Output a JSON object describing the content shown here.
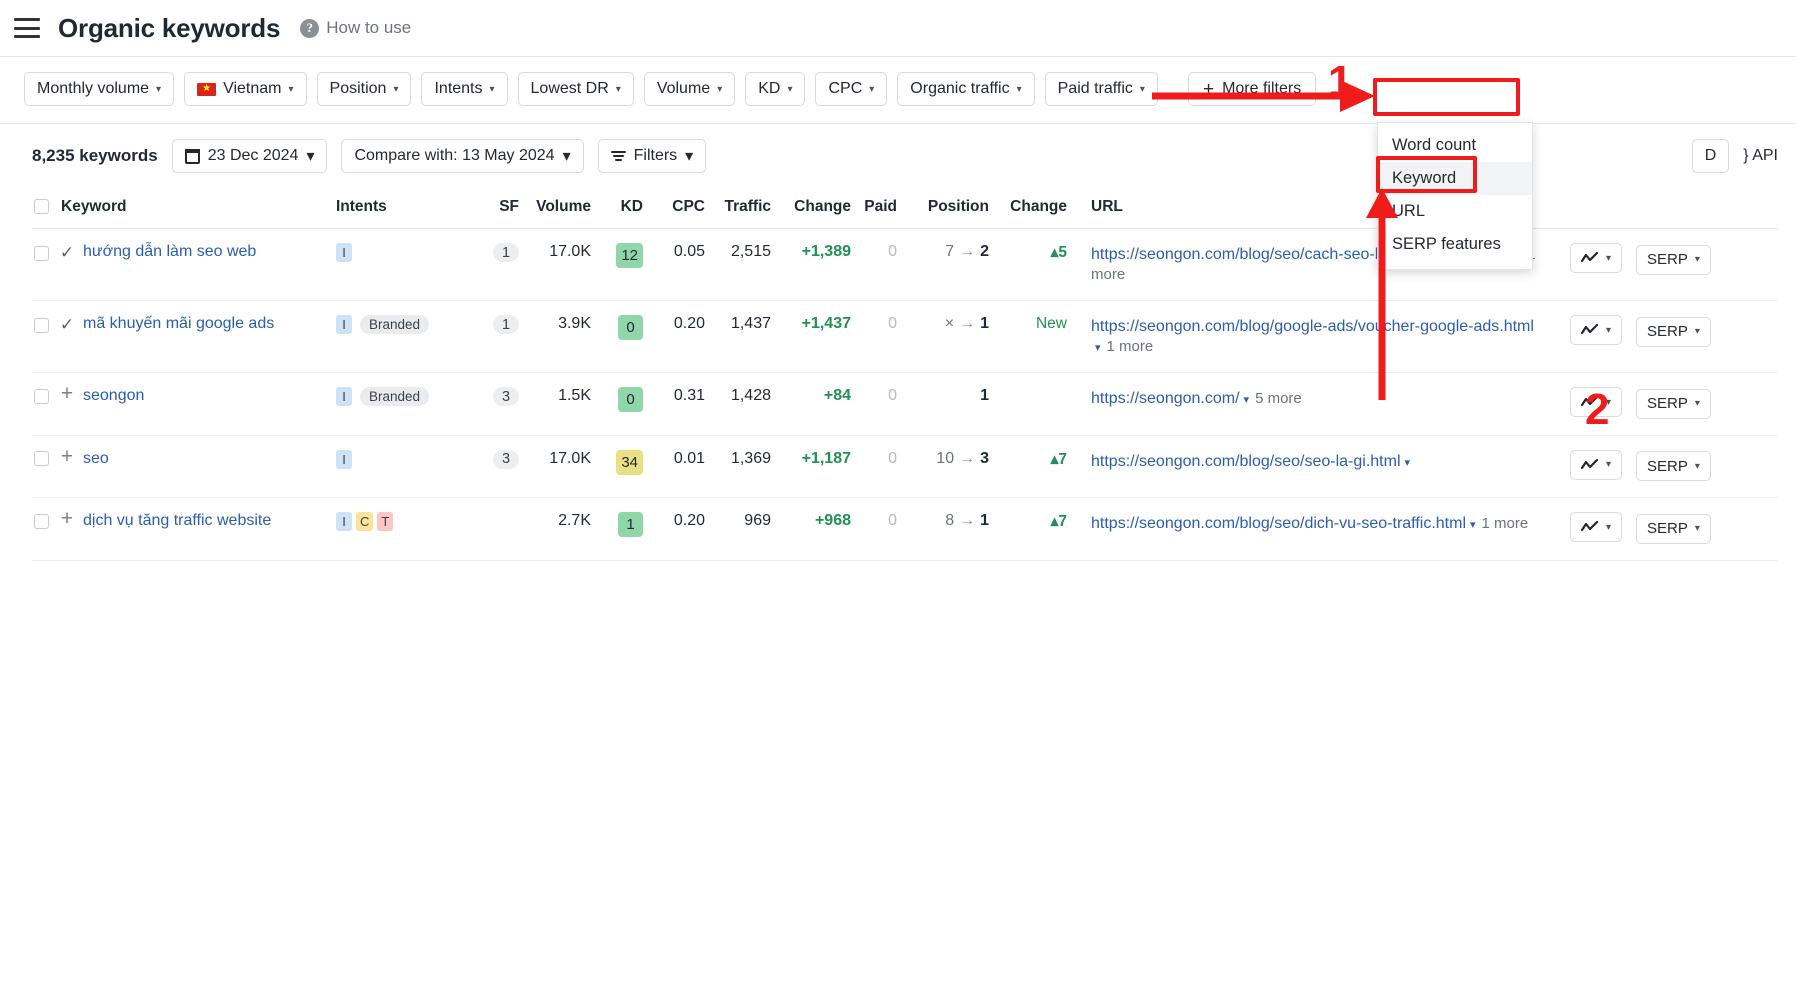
{
  "header": {
    "menu_icon": "hamburger-icon",
    "title": "Organic keywords",
    "help_icon": "?",
    "help_label": "How to use"
  },
  "filter_bar": {
    "buttons": [
      {
        "label": "Monthly volume",
        "caret": "▾"
      },
      {
        "label": "Vietnam",
        "caret": "▾",
        "flag": "★"
      },
      {
        "label": "Position",
        "caret": "▾"
      },
      {
        "label": "Intents",
        "caret": "▾"
      },
      {
        "label": "Lowest DR",
        "caret": "▾"
      },
      {
        "label": "Volume",
        "caret": "▾"
      },
      {
        "label": "KD",
        "caret": "▾"
      },
      {
        "label": "CPC",
        "caret": "▾"
      },
      {
        "label": "Organic traffic",
        "caret": "▾"
      },
      {
        "label": "Paid traffic",
        "caret": "▾"
      }
    ],
    "more_filters": {
      "plus": "+",
      "label": "More filters"
    }
  },
  "more_filters_dropdown": {
    "items": [
      {
        "label": "Word count",
        "highlighted": false
      },
      {
        "label": "Keyword",
        "highlighted": true
      },
      {
        "label": "URL",
        "highlighted": false
      },
      {
        "label": "SERP features",
        "highlighted": false
      }
    ]
  },
  "toolbar": {
    "keyword_count": "8,235 keywords",
    "date_button": "23 Dec 2024",
    "date_caret": "▾",
    "compare_button": "Compare with: 13 May 2024",
    "compare_caret": "▾",
    "filters_button": "Filters",
    "filters_caret": "▾",
    "export_label": "D",
    "api_label": "} API"
  },
  "table": {
    "columns": [
      "Keyword",
      "Intents",
      "SF",
      "Volume",
      "KD",
      "CPC",
      "Traffic",
      "Change",
      "Paid",
      "Position",
      "Change",
      "URL"
    ],
    "rows": [
      {
        "checked": false,
        "mark": "✓",
        "keyword": "hướng dẫn làm seo web",
        "intents": [
          {
            "code": "I",
            "type": "i"
          }
        ],
        "branded": null,
        "sf": "1",
        "volume": "17.0K",
        "kd": "12",
        "kd_color": "green",
        "cpc": "0.05",
        "traffic": "2,515",
        "change": "+1,389",
        "paid": "0",
        "pos_from": "7",
        "pos_arrow": "→",
        "pos_to": "2",
        "pos_change": "▴5",
        "pos_change_type": "up",
        "url": "https://seongon.com/blog/seo/cach-seo-len-top-google.html",
        "url_caret": "▾",
        "url_more": "1 more",
        "chart_button": "chart",
        "serp_button": "SERP"
      },
      {
        "checked": false,
        "mark": "✓",
        "keyword": "mã khuyến mãi google ads",
        "intents": [
          {
            "code": "I",
            "type": "i"
          }
        ],
        "branded": "Branded",
        "sf": "1",
        "volume": "3.9K",
        "kd": "0",
        "kd_color": "green",
        "cpc": "0.20",
        "traffic": "1,437",
        "change": "+1,437",
        "paid": "0",
        "pos_from": "×",
        "pos_arrow": "→",
        "pos_to": "1",
        "pos_change": "New",
        "pos_change_type": "new",
        "url": "https://seongon.com/blog/google-ads/voucher-google-ads.html",
        "url_caret": "▾",
        "url_more": "1 more",
        "chart_button": "chart",
        "serp_button": "SERP"
      },
      {
        "checked": false,
        "mark": "+",
        "keyword": "seongon",
        "intents": [
          {
            "code": "I",
            "type": "i"
          }
        ],
        "branded": "Branded",
        "sf": "3",
        "volume": "1.5K",
        "kd": "0",
        "kd_color": "green",
        "cpc": "0.31",
        "traffic": "1,428",
        "change": "+84",
        "paid": "0",
        "pos_from": "",
        "pos_arrow": "",
        "pos_to": "1",
        "pos_change": "",
        "pos_change_type": "none",
        "url": "https://seongon.com/",
        "url_caret": "▾",
        "url_more": "5 more",
        "chart_button": "chart",
        "serp_button": "SERP"
      },
      {
        "checked": false,
        "mark": "+",
        "keyword": "seo",
        "intents": [
          {
            "code": "I",
            "type": "i"
          }
        ],
        "branded": null,
        "sf": "3",
        "volume": "17.0K",
        "kd": "34",
        "kd_color": "yellow",
        "cpc": "0.01",
        "traffic": "1,369",
        "change": "+1,187",
        "paid": "0",
        "pos_from": "10",
        "pos_arrow": "→",
        "pos_to": "3",
        "pos_change": "▴7",
        "pos_change_type": "up",
        "url": "https://seongon.com/blog/seo/seo-la-gi.html",
        "url_caret": "▾",
        "url_more": "",
        "chart_button": "chart",
        "serp_button": "SERP"
      },
      {
        "checked": false,
        "mark": "+",
        "keyword": "dịch vụ tăng traffic website",
        "intents": [
          {
            "code": "I",
            "type": "i"
          },
          {
            "code": "C",
            "type": "c"
          },
          {
            "code": "T",
            "type": "t"
          }
        ],
        "branded": null,
        "sf": "",
        "volume": "2.7K",
        "kd": "1",
        "kd_color": "green",
        "cpc": "0.20",
        "traffic": "969",
        "change": "+968",
        "paid": "0",
        "pos_from": "8",
        "pos_arrow": "→",
        "pos_to": "1",
        "pos_change": "▴7",
        "pos_change_type": "up",
        "url": "https://seongon.com/blog/seo/dich-vu-seo-traffic.html",
        "url_caret": "▾",
        "url_more": "1 more",
        "chart_button": "chart",
        "serp_button": "SERP"
      }
    ]
  },
  "annotations": {
    "color": "#f01c1c",
    "step1": "1",
    "step2": "2"
  }
}
